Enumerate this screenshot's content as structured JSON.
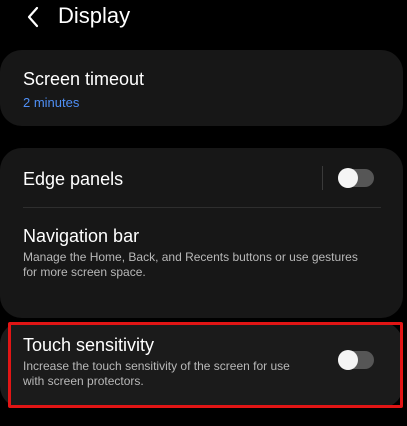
{
  "header": {
    "back_icon": "chevron-left-icon",
    "title": "Display"
  },
  "screen_timeout": {
    "title": "Screen timeout",
    "value": "2 minutes"
  },
  "edge_panels": {
    "title": "Edge panels",
    "enabled": false
  },
  "navigation_bar": {
    "title": "Navigation bar",
    "description": "Manage the Home, Back, and Recents buttons or use gestures for more screen space."
  },
  "touch_sensitivity": {
    "title": "Touch sensitivity",
    "description": "Increase the touch sensitivity of the screen for use with screen protectors.",
    "enabled": false
  },
  "colors": {
    "background": "#000000",
    "card": "#171717",
    "accent": "#4f8ff5",
    "highlight": "#e11515",
    "toggle_off_track": "#565656"
  }
}
